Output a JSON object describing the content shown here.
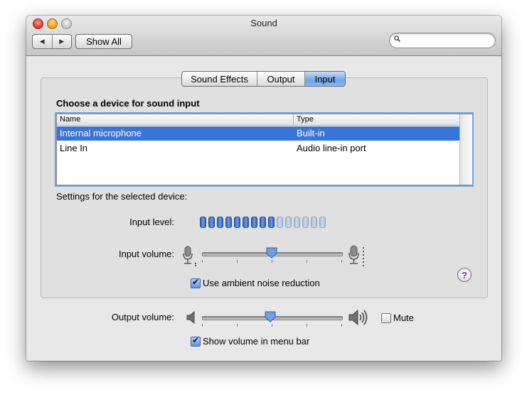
{
  "window": {
    "title": "Sound"
  },
  "toolbar": {
    "back_icon": "◀",
    "forward_icon": "▶",
    "show_all_label": "Show All",
    "search_placeholder": "",
    "search_value": ""
  },
  "tabs": [
    {
      "label": "Sound Effects",
      "selected": false
    },
    {
      "label": "Output",
      "selected": false
    },
    {
      "label": "Input",
      "selected": true
    }
  ],
  "input": {
    "heading": "Choose a device for sound input",
    "columns": [
      "Name",
      "Type"
    ],
    "devices": [
      {
        "name": "Internal microphone",
        "type": "Built-in",
        "selected": true
      },
      {
        "name": "Line In",
        "type": "Audio line-in port",
        "selected": false
      }
    ],
    "settings_label": "Settings for the selected device:",
    "input_level_label": "Input level:",
    "input_level": {
      "lit_segments": 9,
      "total_segments": 15
    },
    "input_volume_label": "Input volume:",
    "input_volume_fraction": 0.5,
    "ambient_noise_label": "Use ambient noise reduction",
    "ambient_noise_checked": true,
    "help_glyph": "?"
  },
  "output": {
    "output_volume_label": "Output volume:",
    "output_volume_fraction": 0.49,
    "mute_label": "Mute",
    "mute_checked": false,
    "show_volume_label": "Show volume in menu bar",
    "show_volume_checked": true
  },
  "icons": {
    "close": "close-button-icon",
    "minimize": "minimize-button-icon",
    "zoom": "zoom-button-icon",
    "search": "search-icon",
    "mic_low": "microphone-low-icon",
    "mic_high": "microphone-high-icon",
    "speaker_low": "speaker-low-icon",
    "speaker_high": "speaker-high-icon",
    "help": "help-icon"
  },
  "colors": {
    "selection": "#3875d7",
    "accent": "#6ea6e8",
    "help": "#6a2fb1"
  }
}
